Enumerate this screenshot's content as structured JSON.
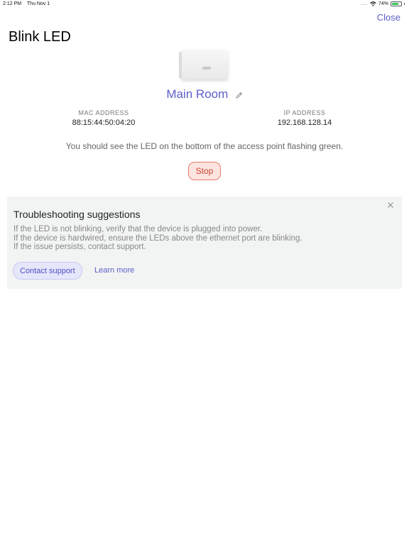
{
  "status_bar": {
    "time": "2:12 PM",
    "date": "Thu Nov 1",
    "signal_dots": "....",
    "battery_percent": "74%",
    "battery_level": 0.74
  },
  "header": {
    "close_label": "Close",
    "title": "Blink LED"
  },
  "device": {
    "name": "Main Room",
    "mac_label": "MAC ADDRESS",
    "mac_value": "88:15:44:50:04:20",
    "ip_label": "IP ADDRESS",
    "ip_value": "192.168.128.14"
  },
  "led_message": "You should see the LED on the bottom of the access point flashing green.",
  "stop_label": "Stop",
  "troubleshooting": {
    "title": "Troubleshooting suggestions",
    "lines": [
      "If the LED is not blinking, verify that the device is plugged into power.",
      "If the device is hardwired, ensure the LEDs above the ethernet port are blinking.",
      "If the issue persists, contact support."
    ],
    "contact_label": "Contact support",
    "learn_more_label": "Learn more"
  },
  "colors": {
    "accent": "#5b5fc7",
    "stop_text": "#c9412d",
    "stop_bg": "#fde4df",
    "card_bg": "#f2f3f3"
  },
  "icons": [
    "wifi-icon",
    "battery-icon",
    "edit-pencil-icon",
    "close-x-icon"
  ]
}
